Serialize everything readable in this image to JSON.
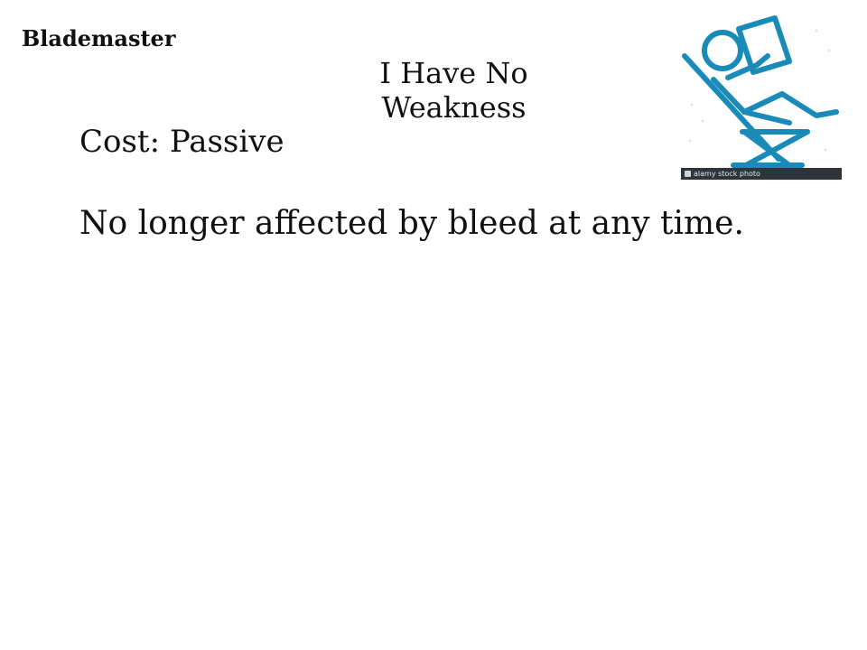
{
  "card": {
    "class_name": "Blademaster",
    "title": "I Have No Weakness",
    "cost": "Cost: Passive",
    "description": "No longer affected by bleed at any time."
  },
  "art": {
    "icon": "person-reclining-reading-icon",
    "stroke_color": "#1a8ab8",
    "watermark": "alamy stock photo"
  }
}
